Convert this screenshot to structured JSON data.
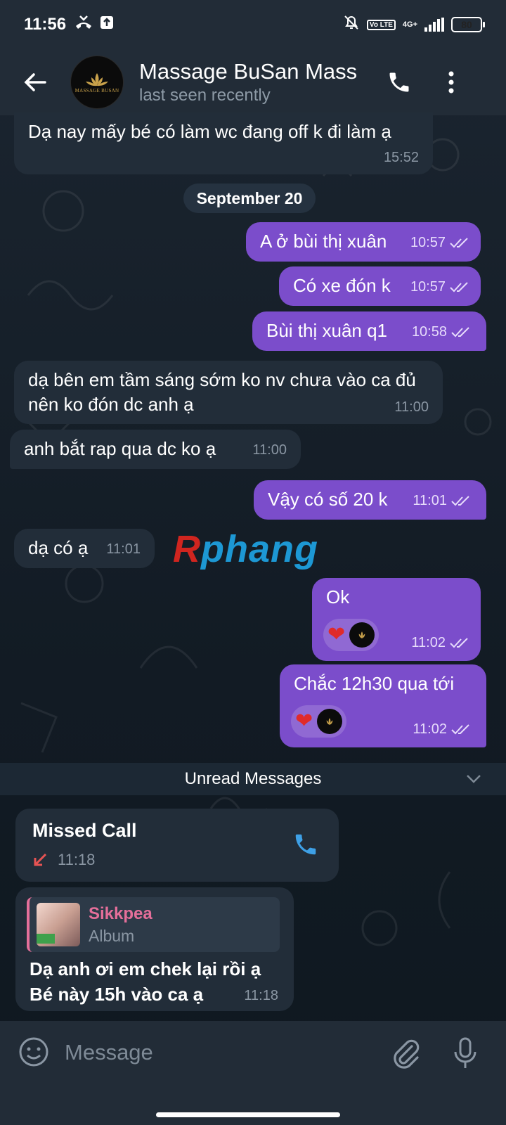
{
  "status_bar": {
    "time": "11:56",
    "network": "4G+",
    "volte": "Vo LTE",
    "battery": "80"
  },
  "header": {
    "title": "Massage BuSan Mass",
    "subtitle": "last seen recently",
    "avatar_text": "MASSAGE BUSAN"
  },
  "messages": [
    {
      "dir": "in",
      "text": "Dạ nay mấy bé có làm wc đang off k đi làm ạ",
      "time": "15:52"
    },
    {
      "dir": "out",
      "text": "A ở bùi thị xuân",
      "time": "10:57"
    },
    {
      "dir": "out",
      "text": "Có xe đón k",
      "time": "10:57"
    },
    {
      "dir": "out",
      "text": "Bùi thị xuân q1",
      "time": "10:58"
    },
    {
      "dir": "in",
      "text": "dạ bên em tầm sáng sớm ko nv chưa vào ca đủ nên ko đón dc anh ạ",
      "time": "11:00"
    },
    {
      "dir": "in",
      "text": "anh bắt rap qua dc ko ạ",
      "time": "11:00"
    },
    {
      "dir": "out",
      "text": "Vậy có số 20 k",
      "time": "11:01"
    },
    {
      "dir": "in",
      "text": "dạ có ạ",
      "time": "11:01"
    },
    {
      "dir": "out",
      "text": "Ok",
      "time": "11:02",
      "reaction": "❤"
    },
    {
      "dir": "out",
      "text": "Chắc 12h30 qua tới",
      "time": "11:02",
      "reaction": "❤"
    }
  ],
  "date_separator": "September 20",
  "watermark": {
    "first": "R",
    "rest": "phang"
  },
  "unread_label": "Unread Messages",
  "missed_call": {
    "title": "Missed Call",
    "time": "11:18"
  },
  "reply_message": {
    "quote_name": "Sikkpea",
    "quote_kind": "Album",
    "text": "Dạ anh ơi em chek lại rồi ạ Bé này 15h vào ca ạ",
    "time": "11:18"
  },
  "input": {
    "placeholder": "Message"
  },
  "colors": {
    "outgoing": "#7b4dcb",
    "incoming": "#222d39",
    "accent": "#3ea0e6"
  }
}
